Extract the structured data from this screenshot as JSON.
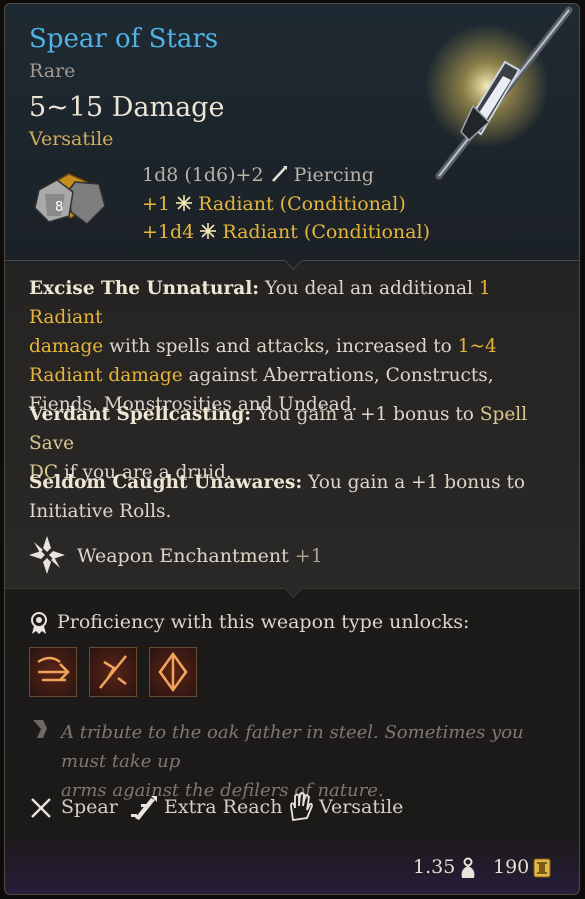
{
  "item": {
    "name": "Spear of Stars",
    "rarity": "Rare",
    "damage": "5~15 Damage",
    "versatile_label": "Versatile"
  },
  "dice": {
    "visible_face": "8",
    "base": "1d8 (1d6)+2",
    "base_type": "Piercing",
    "bonus1_amount": "+1",
    "bonus1_type": "Radiant (Conditional)",
    "bonus2_amount": "+1d4",
    "bonus2_type": "Radiant (Conditional)"
  },
  "passives": [
    {
      "name": "Excise The Unnatural:",
      "text_a": "You deal an additional",
      "hl_a": "1 Radiant",
      "hl_b": "damage",
      "text_b": "with spells and attacks, increased to",
      "hl_c": "1~4",
      "hl_d": "Radiant damage",
      "text_c": "against Aberrations, Constructs,",
      "text_d": "Fiends, Monstrosities and Undead."
    },
    {
      "name": "Verdant Spellcasting:",
      "text_a": "You gain a +1 bonus to",
      "hl_a": "Spell Save",
      "hl_b": "DC",
      "text_b": "if you are a druid."
    },
    {
      "name": "Seldom Caught Unawares:",
      "text_a": "You gain a +1 bonus to",
      "text_b": "Initiative Rolls."
    }
  ],
  "enchantment": {
    "label": "Weapon Enchantment",
    "value": "+1"
  },
  "proficiency": {
    "label": "Proficiency with this weapon type unlocks:"
  },
  "lore": {
    "line1": "A tribute to the oak father in steel. Sometimes you must take up",
    "line2": "arms against the defilers of nature."
  },
  "properties": [
    {
      "label": "Spear",
      "icon": "crossed-spears-icon"
    },
    {
      "label": "Extra Reach",
      "icon": "extra-reach-icon"
    },
    {
      "label": "Versatile",
      "icon": "hand-icon"
    }
  ],
  "footer": {
    "weight": "1.35",
    "price": "190"
  },
  "colors": {
    "title": "#4fb3e8",
    "gold": "#e7b53c",
    "body": "#dcd5c8",
    "muted": "#7e786f"
  }
}
